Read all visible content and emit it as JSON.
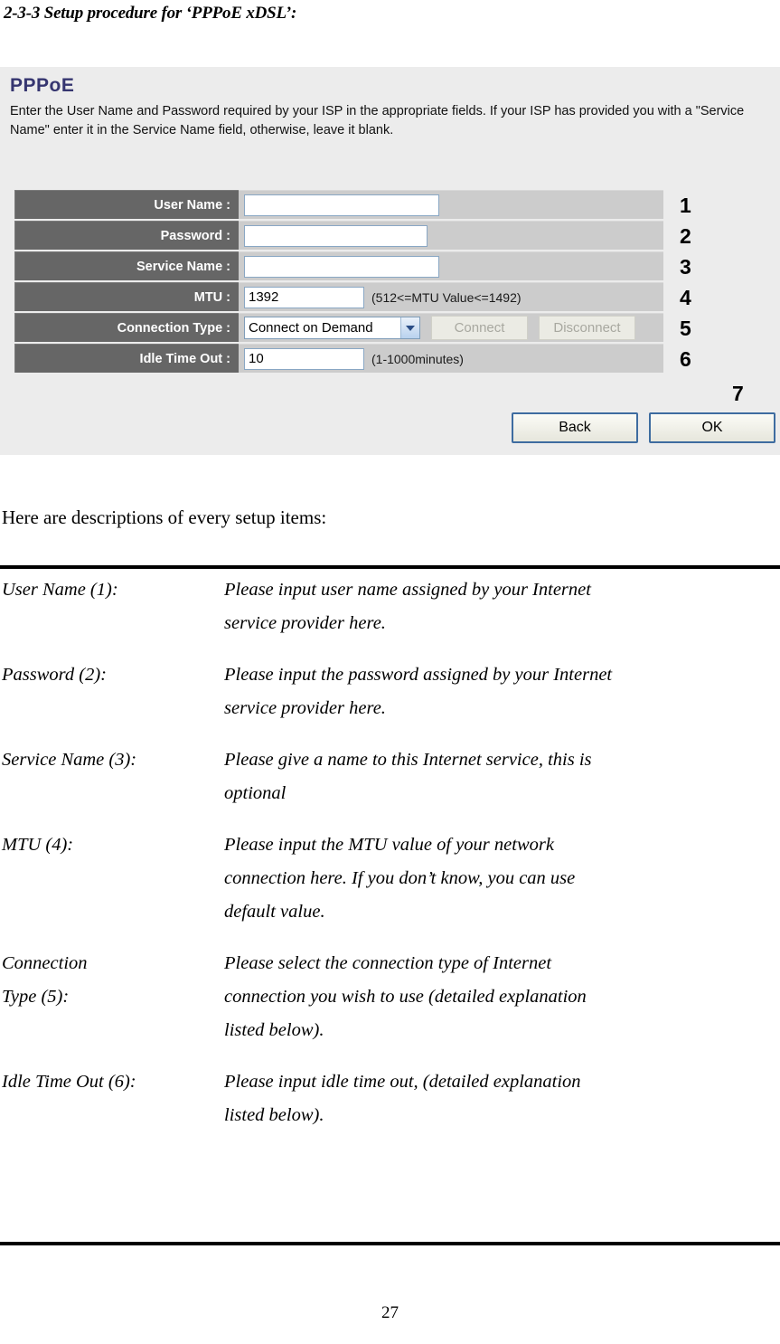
{
  "heading": "2-3-3 Setup procedure for ‘PPPoE xDSL’:",
  "screenshot": {
    "title": "PPPoE",
    "description": "Enter the User Name and Password required by your ISP in the appropriate fields. If your ISP has provided you with a \"Service Name\" enter it in the Service Name field, otherwise, leave it blank.",
    "title_color": "#363670",
    "label_bg": "#666666",
    "value_bg": "#cccccc",
    "panel_bg": "#ececec",
    "rows": [
      {
        "label": "User Name :",
        "value": "",
        "hint": "",
        "callout": "1"
      },
      {
        "label": "Password :",
        "value": "",
        "hint": "",
        "callout": "2"
      },
      {
        "label": "Service Name :",
        "value": "",
        "hint": "",
        "callout": "3"
      },
      {
        "label": "MTU :",
        "value": "1392",
        "hint": "(512<=MTU Value<=1492)",
        "callout": "4"
      },
      {
        "label": "Connection Type :",
        "value": "Connect on Demand",
        "hint": "",
        "callout": "5"
      },
      {
        "label": "Idle Time Out :",
        "value": "10",
        "hint": "(1-1000minutes)",
        "callout": "6"
      }
    ],
    "connect_button": "Connect",
    "disconnect_button": "Disconnect",
    "back_button": "Back",
    "ok_button": "OK",
    "actions_callout": "7"
  },
  "lead_text": "Here are descriptions of every setup items:",
  "definitions": [
    {
      "term_lines": [
        "User Name (1):"
      ],
      "desc_lines": [
        "Please input user name assigned by your Internet",
        "service provider here."
      ]
    },
    {
      "term_lines": [
        "Password (2):"
      ],
      "desc_lines": [
        "Please input the password assigned by your Internet",
        "service provider here."
      ]
    },
    {
      "term_lines": [
        "Service Name (3):"
      ],
      "desc_lines": [
        "Please give a name to this Internet service, this is",
        "optional"
      ]
    },
    {
      "term_lines": [
        "MTU (4):"
      ],
      "desc_lines": [
        "Please input the MTU value of your network",
        "connection here. If you don’t know, you can use",
        "default value."
      ]
    },
    {
      "term_lines": [
        "Connection",
        "Type (5):"
      ],
      "desc_lines": [
        "Please select the connection type of Internet",
        "connection you wish to use (detailed explanation",
        "listed below)."
      ]
    },
    {
      "term_lines": [
        "Idle Time Out (6):"
      ],
      "desc_lines": [
        "Please input idle time out, (detailed explanation",
        "listed below)."
      ]
    }
  ],
  "page_number": "27"
}
